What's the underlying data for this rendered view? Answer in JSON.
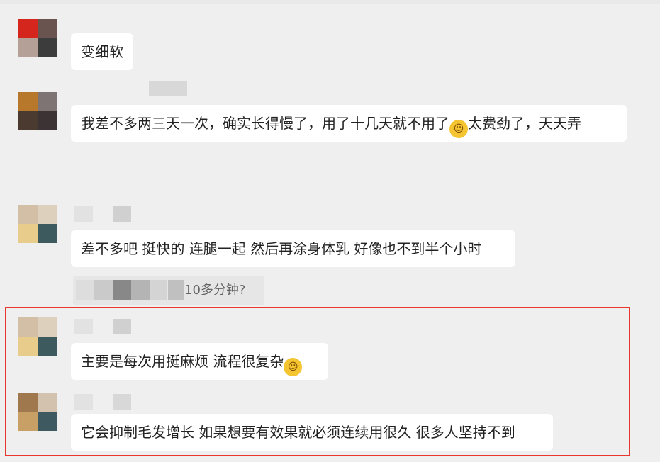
{
  "comments": [
    {
      "id": "c1",
      "text": "变细软"
    },
    {
      "id": "c2",
      "text_before_emoji": "我差不多两三天一次，确实长得慢了，用了十几天就不用了",
      "emoji": "crying-laughing-emoji",
      "text_after_emoji": "太费劲了，天天弄"
    },
    {
      "id": "c3",
      "text": "差不多吧 挺快的 连腿一起 然后再涂身体乳 好像也不到半个小时",
      "quote": "10多分钟?"
    },
    {
      "id": "c4",
      "text_before_emoji": "主要是每次用挺麻烦 流程很复杂",
      "emoji": "laughing-emoji"
    },
    {
      "id": "c5",
      "text": "它会抑制毛发增长 如果想要有效果就必须连续用很久 很多人坚持不到"
    }
  ],
  "colors": {
    "highlight_border": "#e8372f",
    "background": "#efefef",
    "bubble": "#ffffff"
  }
}
